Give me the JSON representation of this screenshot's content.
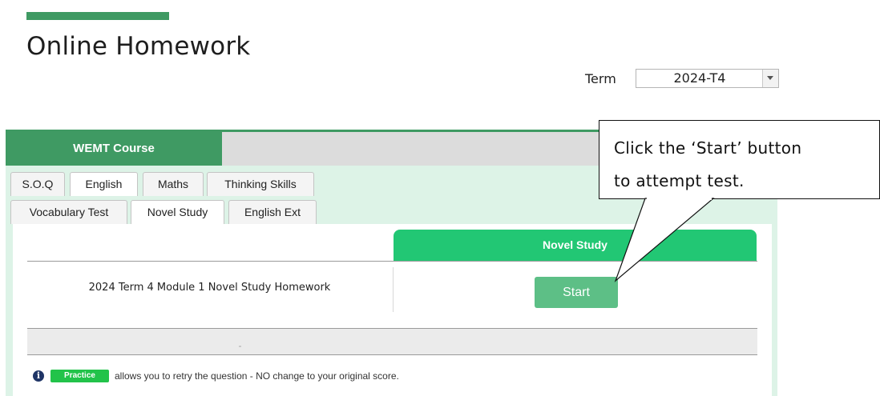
{
  "header": {
    "title": "Online Homework"
  },
  "term": {
    "label": "Term",
    "selected": "2024-T4"
  },
  "course": {
    "tab_label": "WEMT Course"
  },
  "subject_tabs": [
    "S.O.Q",
    "English",
    "Maths",
    "Thinking Skills"
  ],
  "english_tabs": [
    "Vocabulary Test",
    "Novel Study",
    "English Ext"
  ],
  "section": {
    "header": "Novel Study",
    "row_label": "2024 Term 4 Module 1 Novel Study Homework",
    "start_label": "Start"
  },
  "note": {
    "badge": "Practice",
    "text": "allows you to retry the question - NO change to your original score."
  },
  "callout": {
    "line1": "Click the ‘Start’ button",
    "line2": "to attempt test."
  },
  "colors": {
    "brand_green": "#3f9a63",
    "section_green": "#22c774",
    "start_green": "#5dbf86",
    "practice_green": "#22c34a",
    "panel_mint": "#ddf3e7",
    "info_navy": "#1f3566"
  },
  "icons": {
    "info": "info-icon",
    "dropdown": "chevron-down-icon"
  }
}
